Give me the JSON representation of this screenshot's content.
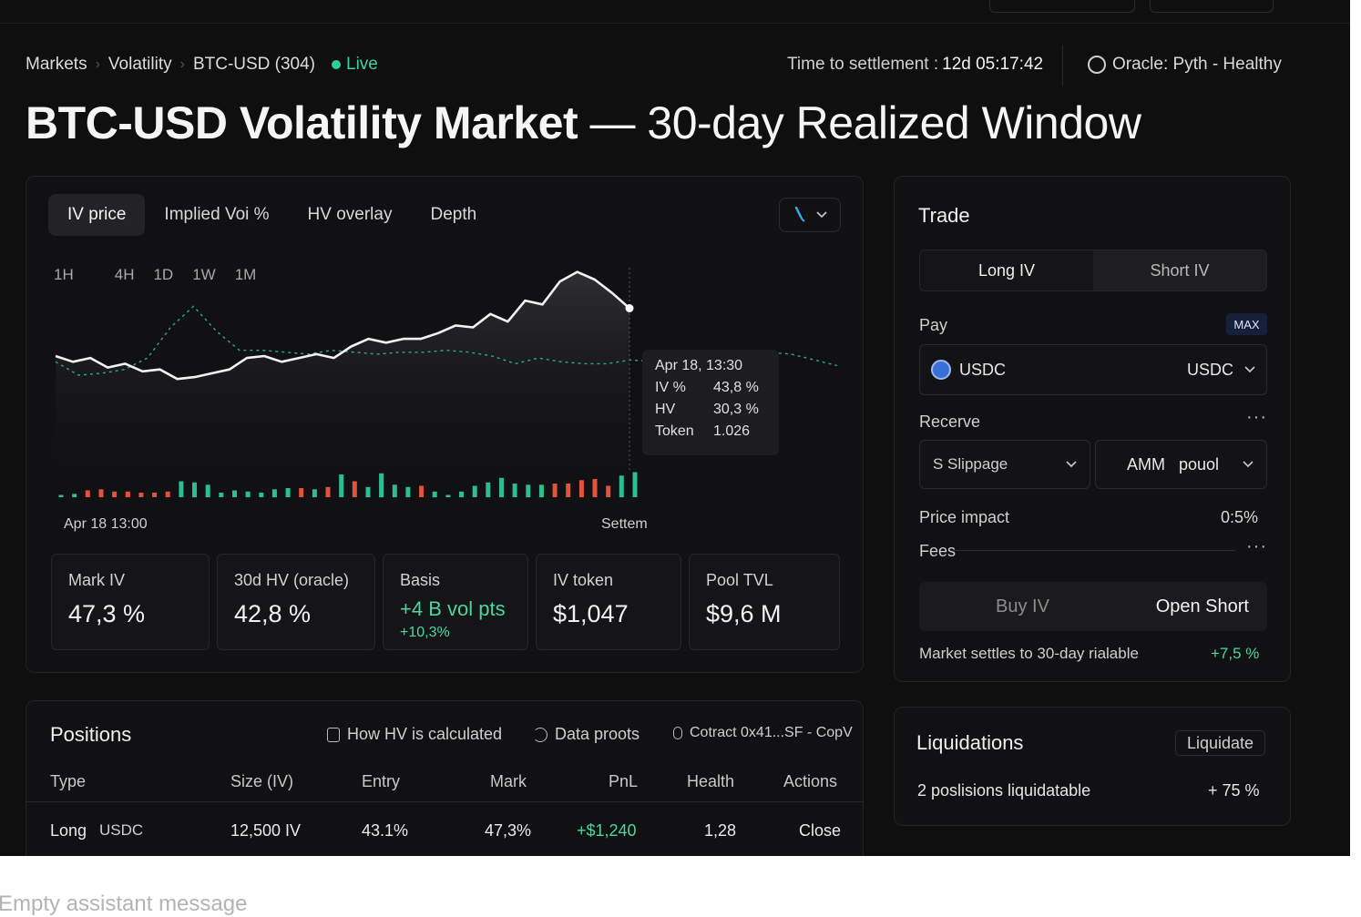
{
  "breadcrumbs": [
    "Markets",
    "Volatility",
    "BTC-USD (304)"
  ],
  "live_label": "Live",
  "settlement": {
    "label": "Time to settlement :",
    "value": "12d 05:17:42"
  },
  "oracle": {
    "label": "Oracle: Pyth - Healthy"
  },
  "title": {
    "bold": "BTC-USD Volatility Market",
    "rest": " — 30-day Realized Window"
  },
  "tabs": [
    "IV price",
    "Implied Voi %",
    "HV overlay",
    "Depth"
  ],
  "tool_icon": "brush-icon",
  "ranges": [
    "1H",
    "4H",
    "1D",
    "1W",
    "1M"
  ],
  "tooltip": {
    "time": "Apr 18, 13:30",
    "rows": [
      {
        "k": "IV %",
        "v": "43,8 %"
      },
      {
        "k": "HV",
        "v": "30,3 %"
      },
      {
        "k": "Token",
        "v": "1.026"
      }
    ]
  },
  "x_labels": {
    "start": "Apr 18  13:00",
    "end": "Settem"
  },
  "chart_data": {
    "type": "line",
    "series": [
      {
        "name": "IV %",
        "values": [
          30,
          27,
          29,
          24,
          26,
          22,
          23,
          18,
          19,
          21,
          23,
          29,
          30,
          27,
          29,
          31,
          29,
          35,
          39,
          37,
          39,
          39,
          42,
          46,
          45,
          52,
          48,
          59,
          57,
          69,
          74,
          70,
          63,
          55
        ]
      },
      {
        "name": "HV",
        "values": [
          27,
          20,
          21,
          23,
          29,
          45,
          56,
          43,
          33,
          33,
          32,
          31,
          33,
          32,
          31,
          32,
          32,
          33,
          32,
          30,
          26,
          29,
          27,
          26,
          26,
          28,
          27,
          28,
          29,
          26,
          31,
          32,
          31,
          28,
          25
        ]
      }
    ],
    "volume": {
      "values": [
        2,
        3,
        6,
        7,
        5,
        5,
        4,
        4,
        5,
        14,
        13,
        11,
        4,
        6,
        5,
        4,
        7,
        8,
        8,
        7,
        9,
        20,
        14,
        9,
        21,
        11,
        9,
        10,
        5,
        2,
        5,
        10,
        13,
        17,
        12,
        11,
        11,
        12,
        12,
        15,
        16,
        10,
        19,
        22
      ],
      "up": [
        1,
        1,
        0,
        0,
        0,
        0,
        0,
        0,
        0,
        1,
        1,
        1,
        1,
        1,
        1,
        1,
        1,
        1,
        0,
        1,
        0,
        1,
        0,
        1,
        1,
        1,
        1,
        0,
        1,
        1,
        1,
        1,
        1,
        1,
        1,
        1,
        1,
        0,
        0,
        0,
        0,
        0,
        1,
        1
      ]
    },
    "colors": {
      "iv": "#f2f2f2",
      "hv": "#2ea88a",
      "up": "#2bbf8f",
      "down": "#e2533f"
    }
  },
  "stats": [
    {
      "label": "Mark IV",
      "value": "47,3 %"
    },
    {
      "label": "30d HV (oracle)",
      "value": "42,8 %"
    },
    {
      "label": "Basis",
      "value": "+4 B vol pts",
      "sub": "+10,3%"
    },
    {
      "label": "IV token",
      "value": "$1,047"
    },
    {
      "label": "Pool TVL",
      "value": "$9,6 M"
    }
  ],
  "trade": {
    "title": "Trade",
    "long": "Long IV",
    "short": "Short IV",
    "pay_label": "Pay",
    "max": "MAX",
    "pay_token": "USDC",
    "pay_select": "USDC",
    "receive_label": "Recerve",
    "slippage": "S Slippage",
    "amm": "AMM",
    "pool": "pouol",
    "price_impact_label": "Price impact",
    "price_impact": "0:5%",
    "fees_label": "Fees",
    "buy": "Buy IV",
    "open_short": "Open Short",
    "note": "Market settles to 30-day rialable",
    "note_value": "+7,5 %"
  },
  "positions": {
    "title": "Positions",
    "link_hv": "How HV is calculated",
    "link_proofs": "Data proots",
    "link_contract": "Cotract 0x41...SF - CopV",
    "headers": [
      "Type",
      "Size (IV)",
      "Entry",
      "Mark",
      "PnL",
      "Health",
      "Actions"
    ],
    "row": {
      "type": "Long",
      "asset": "USDC",
      "size": "12,500 IV",
      "entry": "43.1%",
      "mark": "47,3%",
      "pnl": "+$1,240",
      "health": "1,28",
      "action": "Close"
    }
  },
  "liquidations": {
    "title": "Liquidations",
    "button": "Liquidate",
    "text": "2 poslisions liquidatable",
    "value": "+ 75 %"
  },
  "below_text": "Empty assistant message"
}
